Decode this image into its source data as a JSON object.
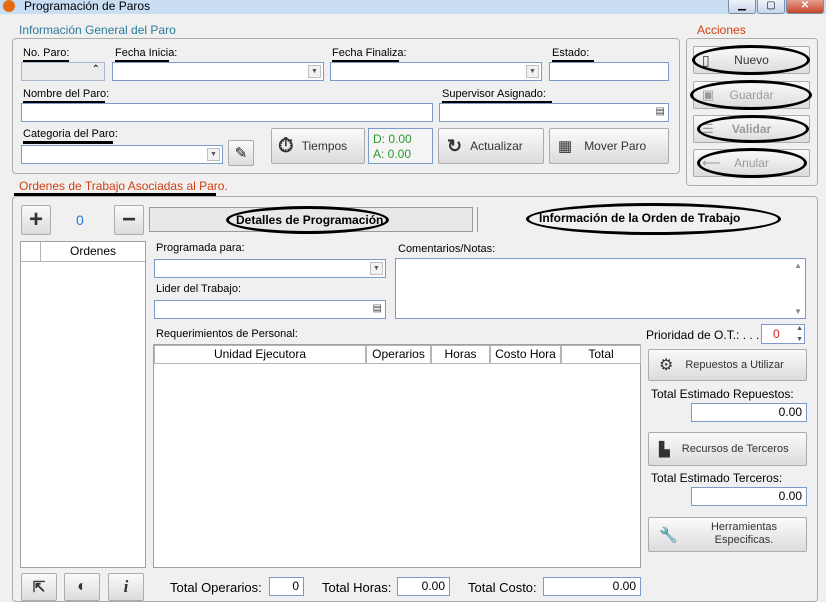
{
  "window": {
    "title": "Programación de Paros",
    "min_glyph": "▁",
    "max_glyph": "▢",
    "close_glyph": "✕"
  },
  "general": {
    "legend": "Información General del Paro",
    "no_paro_label": "No. Paro:",
    "fecha_inicia_label": "Fecha Inicia:",
    "fecha_finaliza_label": "Fecha Finaliza:",
    "estado_label": "Estado:",
    "nombre_label": "Nombre del Paro:",
    "supervisor_label": "Supervisor Asignado:",
    "categoria_label": "Categoria del Paro:",
    "tiempos_label": "Tiempos",
    "d_value": "D: 0.00",
    "a_value": "A: 0.00",
    "actualizar_label": "Actualizar",
    "mover_label": "Mover Paro"
  },
  "acciones": {
    "legend": "Acciones",
    "nuevo": "Nuevo",
    "guardar": "Guardar",
    "validar": "Validar",
    "anular": "Anular"
  },
  "ordenes": {
    "legend": "Ordenes de Trabajo Asociadas al Paro.",
    "count": "0",
    "list_header": "Ordenes"
  },
  "tabs": {
    "detalles": "Detalles de Programación",
    "info_ot": "Información de la Orden de Trabajo"
  },
  "detalles": {
    "programada_label": "Programada para:",
    "lider_label": "Lider del Trabajo:",
    "comentarios_label": "Comentarios/Notas:",
    "requerimientos_label": "Requerimientos de Personal:",
    "columns": [
      "Unidad Ejecutora",
      "Operarios",
      "Horas",
      "Costo Hora",
      "Total"
    ],
    "prioridad_label": "Prioridad de O.T.: . . . .",
    "prioridad_value": "0",
    "repuestos_btn": "Repuestos a Utilizar",
    "total_repuestos_label": "Total Estimado Repuestos:",
    "total_repuestos_value": "0.00",
    "recursos_btn": "Recursos de Terceros",
    "total_terceros_label": "Total Estimado Terceros:",
    "total_terceros_value": "0.00",
    "herramientas_btn_line1": "Herramientas",
    "herramientas_btn_line2": "Especificas."
  },
  "totals": {
    "operarios_label": "Total Operarios:",
    "operarios_value": "0",
    "horas_label": "Total Horas:",
    "horas_value": "0.00",
    "costo_label": "Total Costo:",
    "costo_value": "0.00"
  },
  "colors": {
    "accent_legend": "#2a7a9a",
    "orange_legend": "#d04010",
    "count_blue": "#1f7ae0",
    "prioridad_red": "#d02020"
  }
}
